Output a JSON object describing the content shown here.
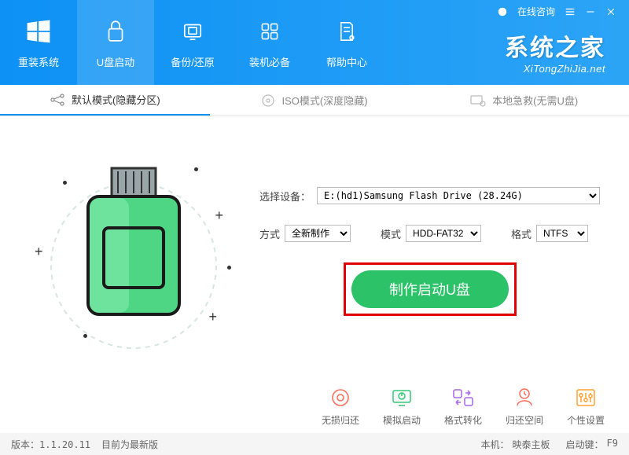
{
  "titlebar": {
    "consult": "在线咨询"
  },
  "brand": {
    "main": "系统之家",
    "sub": "XiTongZhiJia.net"
  },
  "nav": [
    {
      "label": "重装系统"
    },
    {
      "label": "U盘启动"
    },
    {
      "label": "备份/还原"
    },
    {
      "label": "装机必备"
    },
    {
      "label": "帮助中心"
    }
  ],
  "subtabs": [
    {
      "label": "默认模式(隐藏分区)"
    },
    {
      "label": "ISO模式(深度隐藏)"
    },
    {
      "label": "本地急救(无需U盘)"
    }
  ],
  "form": {
    "device_label": "选择设备：",
    "device_value": "E:(hd1)Samsung Flash Drive (28.24G)",
    "method_label": "方式",
    "method_value": "全新制作",
    "mode_label": "模式",
    "mode_value": "HDD-FAT32",
    "format_label": "格式",
    "format_value": "NTFS"
  },
  "create_button": "制作启动U盘",
  "tools": [
    {
      "label": "无损归还"
    },
    {
      "label": "模拟启动"
    },
    {
      "label": "格式转化"
    },
    {
      "label": "归还空间"
    },
    {
      "label": "个性设置"
    }
  ],
  "footer": {
    "version": "版本：1.1.20.11",
    "status": "目前为最新版",
    "host_label": "本机：",
    "host_value": "映泰主板",
    "bootkey_label": "启动键：",
    "bootkey_value": "F9"
  }
}
